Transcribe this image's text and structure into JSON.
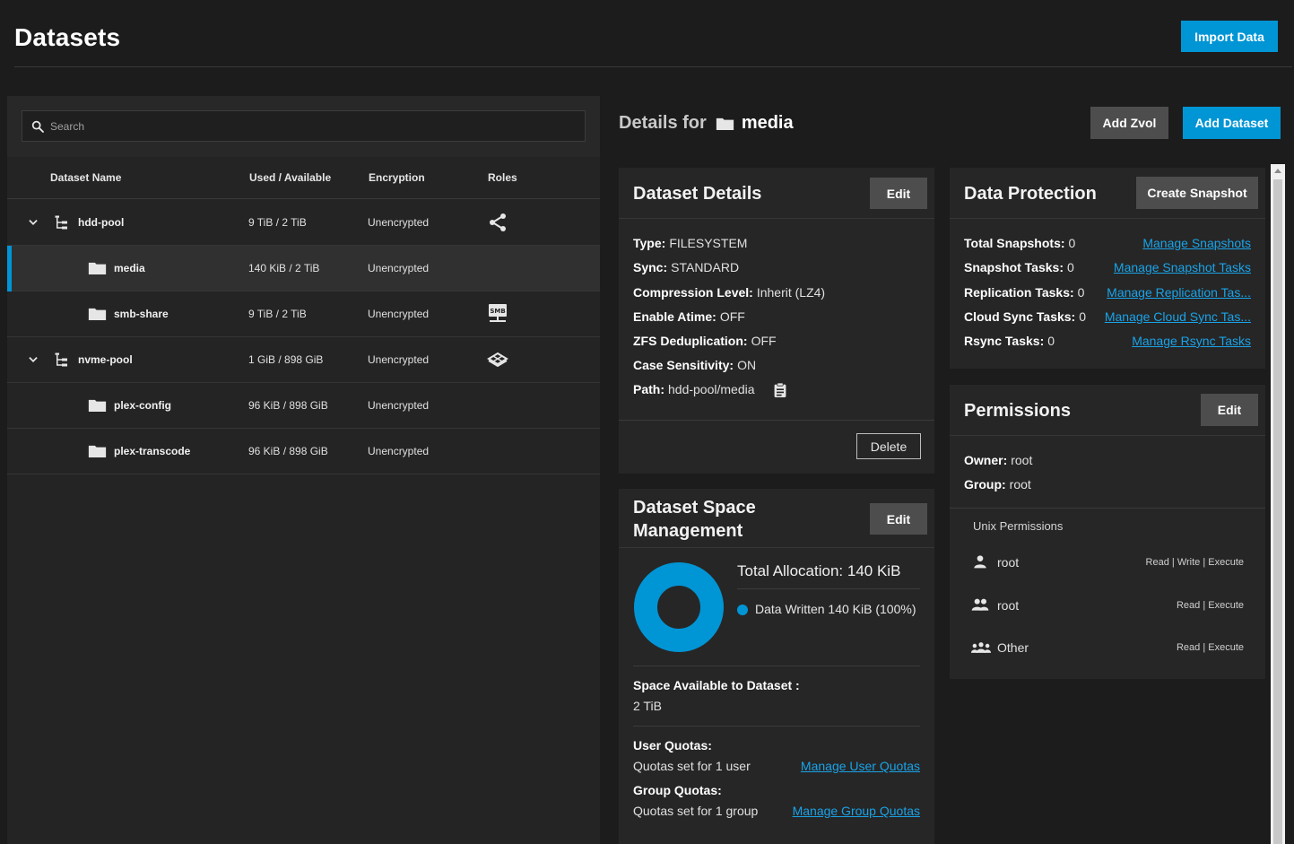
{
  "header": {
    "title": "Datasets",
    "import_label": "Import Data"
  },
  "search": {
    "placeholder": "Search"
  },
  "table": {
    "columns": [
      "Dataset Name",
      "Used / Available",
      "Encryption",
      "Roles"
    ],
    "rows": [
      {
        "name": "hdd-pool",
        "used": "9 TiB / 2 TiB",
        "encryption": "Unencrypted",
        "role": "share-icon"
      },
      {
        "name": "media",
        "used": "140 KiB / 2 TiB",
        "encryption": "Unencrypted",
        "role": ""
      },
      {
        "name": "smb-share",
        "used": "9 TiB / 2 TiB",
        "encryption": "Unencrypted",
        "role": "smb-share-icon"
      },
      {
        "name": "nvme-pool",
        "used": "1 GiB / 898 GiB",
        "encryption": "Unencrypted",
        "role": "application-icon"
      },
      {
        "name": "plex-config",
        "used": "96 KiB / 898 GiB",
        "encryption": "Unencrypted",
        "role": ""
      },
      {
        "name": "plex-transcode",
        "used": "96 KiB / 898 GiB",
        "encryption": "Unencrypted",
        "role": ""
      }
    ]
  },
  "details": {
    "prefix": "Details for",
    "name": "media",
    "add_zvol_label": "Add Zvol",
    "add_dataset_label": "Add Dataset"
  },
  "dataset_details": {
    "title": "Dataset Details",
    "edit_label": "Edit",
    "delete_label": "Delete",
    "items": [
      {
        "label": "Type:",
        "value": "FILESYSTEM"
      },
      {
        "label": "Sync:",
        "value": "STANDARD"
      },
      {
        "label": "Compression Level:",
        "value": "Inherit (LZ4)"
      },
      {
        "label": "Enable Atime:",
        "value": "OFF"
      },
      {
        "label": "ZFS Deduplication:",
        "value": "OFF"
      },
      {
        "label": "Case Sensitivity:",
        "value": "ON"
      },
      {
        "label": "Path:",
        "value": "hdd-pool/media"
      }
    ]
  },
  "space": {
    "title_line1": "Dataset Space",
    "title_line2": "Management",
    "edit_label": "Edit",
    "total_label": "Total Allocation:",
    "total_value": "140 KiB",
    "legend": "Data Written 140 KiB (100%)",
    "chart_color": "#0095d5",
    "data_written_fraction": 1.0,
    "available_label": "Space Available to Dataset :",
    "available_value": "2 TiB",
    "user_quotas_label": "User Quotas:",
    "user_quotas_value": "Quotas set for 1 user",
    "user_quotas_link": "Manage User Quotas",
    "group_quotas_label": "Group Quotas:",
    "group_quotas_value": "Quotas set for 1 group",
    "group_quotas_link": "Manage Group Quotas"
  },
  "protection": {
    "title": "Data Protection",
    "create_snapshot_label": "Create Snapshot",
    "items": [
      {
        "label": "Total Snapshots:",
        "value": "0",
        "link": "Manage Snapshots"
      },
      {
        "label": "Snapshot Tasks:",
        "value": "0",
        "link": "Manage Snapshot Tasks"
      },
      {
        "label": "Replication Tasks:",
        "value": "0",
        "link": "Manage Replication Tas..."
      },
      {
        "label": "Cloud Sync Tasks:",
        "value": "0",
        "link": "Manage Cloud Sync Tas..."
      },
      {
        "label": "Rsync Tasks:",
        "value": "0",
        "link": "Manage Rsync Tasks"
      }
    ]
  },
  "permissions": {
    "title": "Permissions",
    "edit_label": "Edit",
    "owner_label": "Owner:",
    "owner_value": "root",
    "group_label": "Group:",
    "group_value": "root",
    "unix_label": "Unix Permissions",
    "entries": [
      {
        "icon": "user-icon",
        "name": "root",
        "rights": "Read | Write | Execute"
      },
      {
        "icon": "group-icon",
        "name": "root",
        "rights": "Read | Execute"
      },
      {
        "icon": "other-icon",
        "name": "Other",
        "rights": "Read | Execute"
      }
    ]
  }
}
